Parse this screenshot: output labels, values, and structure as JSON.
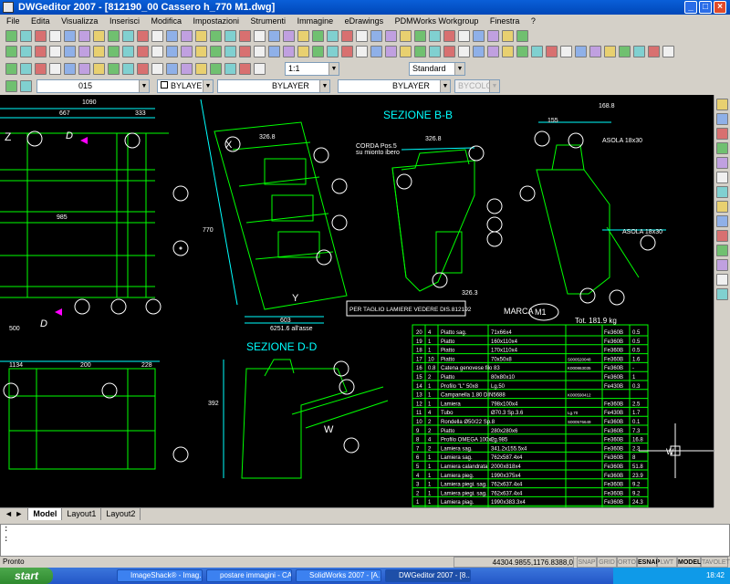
{
  "window": {
    "title": "DWGeditor 2007 - [812190_00 Cassero h_770 M1.dwg]",
    "controls": [
      "_",
      "□",
      "×"
    ]
  },
  "menu": [
    "File",
    "Edita",
    "Visualizza",
    "Inserisci",
    "Modifica",
    "Impostazioni",
    "Strumenti",
    "Immagine",
    "eDrawings",
    "PDMWorks Workgroup",
    "Finestra",
    "?"
  ],
  "toolbar3": {
    "scale_combo": "1:1",
    "style_combo": "Standard"
  },
  "layerbar": {
    "layer": "015",
    "color": "BYLAYER",
    "linetype": "BYLAYER",
    "lineweight": "BYLAYER",
    "plotstyle": "BYCOLOR"
  },
  "drawing": {
    "sezione_bb": "SEZIONE  B-B",
    "sezione_dd": "SEZIONE  D-D",
    "marca_label": "MARCA",
    "marca_value": "M1",
    "tot_label": "Tot.  181.9  kg",
    "per_taglio": "PER TAGLIO LAMIERE VEDERE DIS.812192",
    "asola_label": "ASOLA 18x30",
    "asola_label2": "ASOLA 18x30",
    "corda_label": "CORDA Pos.5",
    "corda_sub": "su mionto ibero",
    "dim_1090": "1090",
    "dim_667": "667",
    "dim_333": "333",
    "dim_985": "985",
    "dim_500": "500",
    "dim_1134": "1134",
    "dim_200": "200",
    "dim_228": "228",
    "dim_326": "326.8",
    "dim_326b": "326.8",
    "dim_326c": "326.3",
    "dim_603": "603",
    "dim_6251": "6251.6 all'asse",
    "dim_770": "770",
    "dim_392": "392",
    "dim_155": "155",
    "dim_168": "168.8",
    "label_z": "Z",
    "label_d": "D",
    "label_d2": "D",
    "label_x": "X",
    "label_y": "Y",
    "label_w": "W",
    "label_w2": "W"
  },
  "bom": [
    {
      "pos": "20",
      "qty": "4",
      "desc": "Piatto sag.",
      "dim": "71x66x4",
      "code": "",
      "mat": "Fe360B",
      "wt": "0.5"
    },
    {
      "pos": "19",
      "qty": "1",
      "desc": "Piatto",
      "dim": "160x110x4",
      "code": "",
      "mat": "Fe360B",
      "wt": "0.5"
    },
    {
      "pos": "18",
      "qty": "1",
      "desc": "Piatto",
      "dim": "170x110x4",
      "code": "",
      "mat": "Fe360B",
      "wt": "0.5"
    },
    {
      "pos": "17",
      "qty": "10",
      "desc": "Piatto",
      "dim": "70x50x8",
      "code": "S000520048",
      "mat": "Fe360B",
      "wt": "1.6"
    },
    {
      "pos": "16",
      "qty": "0.8",
      "desc": "Catena genovese filo 83",
      "dim": "",
      "code": "K000863035",
      "mat": "Fe360B",
      "wt": "-"
    },
    {
      "pos": "15",
      "qty": "2",
      "desc": "Piatto",
      "dim": "80x80x10",
      "code": "",
      "mat": "Fe360B",
      "wt": "1"
    },
    {
      "pos": "14",
      "qty": "1",
      "desc": "Profilo \"L\" 50x8",
      "dim": "Lg.50",
      "code": "",
      "mat": "Fe430B",
      "wt": "0.3"
    },
    {
      "pos": "13",
      "qty": "1",
      "desc": "Campanella 1.80 DIN5688",
      "dim": "",
      "code": "K000590412",
      "mat": "",
      "wt": ""
    },
    {
      "pos": "12",
      "qty": "1",
      "desc": "Lamiera",
      "dim": "798x100x4",
      "code": "",
      "mat": "Fe360B",
      "wt": "2.5"
    },
    {
      "pos": "11",
      "qty": "4",
      "desc": "Tubo",
      "dim": "Ø70.3 Sp.3.6",
      "code": "Lg.70",
      "mat": "Fe430B",
      "wt": "1.7"
    },
    {
      "pos": "10",
      "qty": "2",
      "desc": "Rondella Ø50/22 Sp.8",
      "dim": "",
      "code": "S000576649",
      "mat": "Fe360B",
      "wt": "0.1"
    },
    {
      "pos": "9",
      "qty": "2",
      "desc": "Piatto",
      "dim": "280x280x6",
      "code": "",
      "mat": "Fe360B",
      "wt": "7.3"
    },
    {
      "pos": "8",
      "qty": "4",
      "desc": "Profilo OMEGA 100x2",
      "dim": "Lg.985",
      "code": "",
      "mat": "Fe360B",
      "wt": "16.8"
    },
    {
      "pos": "7",
      "qty": "2",
      "desc": "Lamiera sag.",
      "dim": "341.2x155.5x4",
      "code": "",
      "mat": "Fe360B",
      "wt": "2.3"
    },
    {
      "pos": "6",
      "qty": "1",
      "desc": "Lamiera sag.",
      "dim": "762x587.4x4",
      "code": "",
      "mat": "Fe360B",
      "wt": "8"
    },
    {
      "pos": "5",
      "qty": "1",
      "desc": "Lamiera calandrata",
      "dim": "2000x818x4",
      "code": "",
      "mat": "Fe360B",
      "wt": "51.8"
    },
    {
      "pos": "4",
      "qty": "1",
      "desc": "Lamiera pieg.",
      "dim": "1990x375x4",
      "code": "",
      "mat": "Fe360B",
      "wt": "23.9"
    },
    {
      "pos": "3",
      "qty": "1",
      "desc": "Lamiera piegi. sag.",
      "dim": "762x637.4x4",
      "code": "",
      "mat": "Fe360B",
      "wt": "9.2"
    },
    {
      "pos": "2",
      "qty": "1",
      "desc": "Lamiera piegi. sag.",
      "dim": "762x637.4x4",
      "code": "",
      "mat": "Fe360B",
      "wt": "9.2"
    },
    {
      "pos": "1",
      "qty": "1",
      "desc": "Lamiera piag.",
      "dim": "1990x383.3x4",
      "code": "",
      "mat": "Fe360B",
      "wt": "24.3"
    }
  ],
  "layout_tabs": [
    "Model",
    "Layout1",
    "Layout2"
  ],
  "command": {
    "line1": ":",
    "line2": ":"
  },
  "status": {
    "text": "Pronto",
    "coords": "44304.9855,1176.8388,0",
    "buttons": [
      "SNAP",
      "GRID",
      "ORTO",
      "ESNAP",
      "LWT",
      "MODEL",
      "TAVOLET"
    ]
  },
  "taskbar": {
    "start": "start",
    "tasks": [
      "ImageShack® - Imag...",
      "postare immagini - CA...",
      "SolidWorks 2007 - [A...",
      "DWGeditor 2007 - [8..."
    ],
    "clock": "18:42"
  },
  "colors": {
    "drawing_bg": "#000000",
    "green": "#00ff00",
    "white": "#ffffff",
    "cyan": "#00ffff",
    "magenta": "#ff00ff",
    "titlebar": "#0a5fd8"
  }
}
